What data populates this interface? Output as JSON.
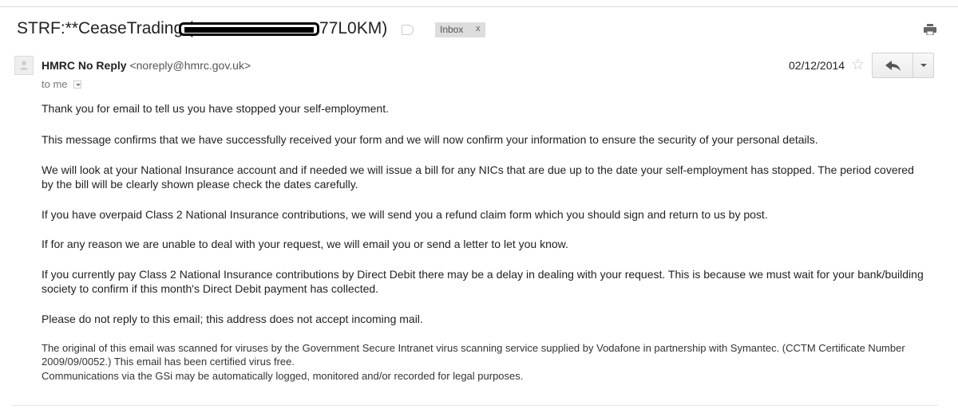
{
  "subject": {
    "prefix": "STRF:**CeaseTrading (",
    "suffix": "77L0KM)",
    "label": "Inbox",
    "label_close": "x"
  },
  "header": {
    "sender_name": "HMRC No Reply",
    "sender_email": "<noreply@hmrc.gov.uk>",
    "recipient": "to me",
    "date": "02/12/2014"
  },
  "icons": {
    "print": "print-icon",
    "star": "star-icon",
    "reply": "reply-icon",
    "more": "chevron-down-icon",
    "avatar": "avatar-icon"
  },
  "body": {
    "p1": "Thank you for email to tell us you have stopped your self-employment.",
    "p2": "This message confirms that we have successfully received your form and we will now confirm your information to ensure the security of your personal details.",
    "p3": "We will look at your National Insurance account and if needed we will issue a bill for any NICs that are due up to the date your self-employment has stopped. The period covered by the bill will be clearly shown please check the dates carefully.",
    "p4": "If you have overpaid Class 2 National Insurance contributions, we will send you a refund claim form which you should sign and return to us by post.",
    "p5": "If for any reason we are unable to deal with your request, we will email you or send a letter to let you know.",
    "p6": "If you currently pay Class 2 National Insurance contributions by Direct Debit there may be a delay in dealing with your request. This is because we must wait for your bank/building society to confirm if this month's Direct Debit payment has collected.",
    "p7": "Please do not reply to this email; this address does not accept incoming mail.",
    "footer1": "The original of this email was scanned for viruses by the Government Secure Intranet virus scanning service supplied by Vodafone in partnership with Symantec. (CCTM Certificate Number 2009/09/0052.) This email has been certified virus free.",
    "footer2": "Communications via the GSi may be automatically logged, monitored and/or recorded for legal purposes."
  }
}
